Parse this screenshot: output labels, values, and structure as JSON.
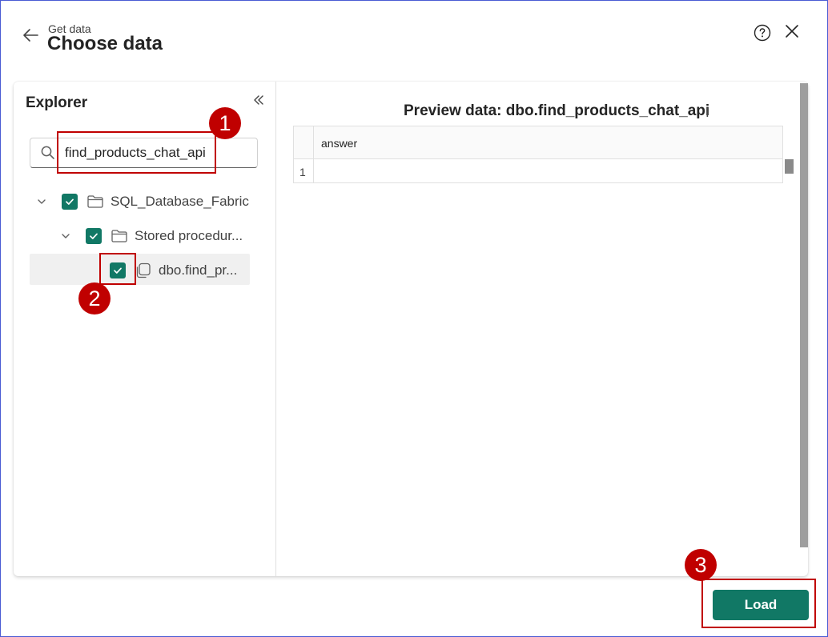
{
  "header": {
    "subtitle": "Get data",
    "title": "Choose data"
  },
  "explorer": {
    "title": "Explorer",
    "search": {
      "value": "find_products_chat_api"
    },
    "tree": [
      {
        "label": "SQL_Database_Fabric",
        "checked": true,
        "expanded": true
      },
      {
        "label": "Stored procedur...",
        "checked": true,
        "expanded": true
      },
      {
        "label": "dbo.find_pr...",
        "checked": true,
        "selected": true
      }
    ]
  },
  "preview": {
    "title": "Preview data: dbo.find_products_chat_api",
    "columns": [
      "answer"
    ],
    "rows": [
      {
        "num": "1",
        "answer": ""
      }
    ]
  },
  "footer": {
    "load_label": "Load"
  },
  "annotations": [
    "1",
    "2",
    "3"
  ],
  "colors": {
    "accent": "#117865",
    "annotation": "#c00000"
  }
}
